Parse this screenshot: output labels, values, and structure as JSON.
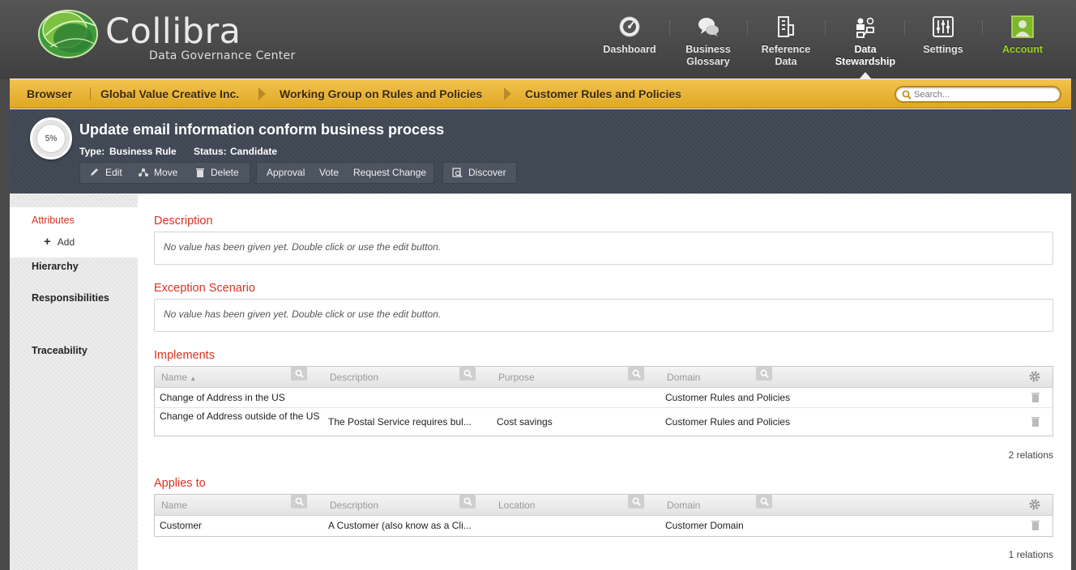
{
  "app": {
    "logo_name": "Collibra",
    "logo_tagline": "Data Governance Center"
  },
  "nav": {
    "items": [
      {
        "label": "Dashboard",
        "icon": "dashboard-icon"
      },
      {
        "label": "Business Glossary",
        "icon": "speech-bubbles-icon"
      },
      {
        "label": "Reference Data",
        "icon": "reference-data-icon"
      },
      {
        "label": "Data Stewardship",
        "icon": "stewardship-icon",
        "active": true
      },
      {
        "label": "Settings",
        "icon": "sliders-icon"
      },
      {
        "label": "Account",
        "icon": "user-avatar-icon"
      }
    ]
  },
  "breadcrumb": {
    "items": [
      "Browser",
      "Global Value Creative Inc.",
      "Working Group on Rules and Policies",
      "Customer Rules and Policies"
    ]
  },
  "search": {
    "placeholder": "Search..."
  },
  "asset": {
    "progress": "5%",
    "title": "Update email information conform business process",
    "type_label": "Type:",
    "type_value": "Business Rule",
    "status_label": "Status:",
    "status_value": "Candidate"
  },
  "toolbar": {
    "edit": "Edit",
    "move": "Move",
    "delete": "Delete",
    "approval": "Approval",
    "vote": "Vote",
    "request_change": "Request Change",
    "discover": "Discover"
  },
  "sidebar": {
    "attributes": "Attributes",
    "add": "Add",
    "hierarchy": "Hierarchy",
    "responsibilities": "Responsibilities",
    "traceability": "Traceability"
  },
  "sections": {
    "description": {
      "title": "Description",
      "empty": "No value has been given yet. Double click or use the edit button."
    },
    "exception": {
      "title": "Exception Scenario",
      "empty": "No value has been given yet. Double click or use the edit button."
    },
    "implements": {
      "title": "Implements",
      "columns": [
        "Name",
        "Description",
        "Purpose",
        "Domain"
      ],
      "sort_indicator": "▲",
      "rows": [
        {
          "name": "Change of Address in the US",
          "description": "",
          "purpose": "",
          "domain": "Customer Rules and Policies"
        },
        {
          "name": "Change of Address outside of the US",
          "description": "The Postal Service requires bul...",
          "purpose": "Cost savings",
          "domain": "Customer Rules and Policies"
        }
      ],
      "count": "2 relations"
    },
    "applies_to": {
      "title": "Applies to",
      "columns": [
        "Name",
        "Description",
        "Location",
        "Domain"
      ],
      "rows": [
        {
          "name": "Customer",
          "description": "A Customer (also know as a Cli...",
          "location": "",
          "domain": "Customer Domain"
        }
      ],
      "count": "1 relations"
    }
  },
  "colors": {
    "accent_red": "#d7321f",
    "link_blue": "#2fa8e0",
    "breadcrumb_gold": "#e8b33a",
    "title_band": "#3e4652",
    "account_green": "#9ad02a"
  }
}
